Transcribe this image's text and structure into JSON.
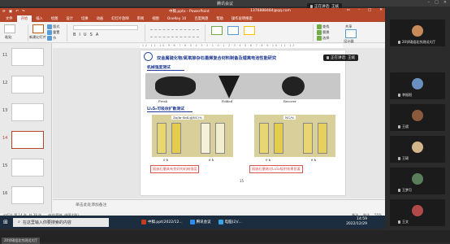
{
  "meeting": {
    "title": "腾讯会议",
    "speaker_label": "正在讲话: 王斌"
  },
  "ppt": {
    "doc_title": "中稿.pptx - PowerPoint",
    "account": "1376888484@qq.com",
    "tabs": [
      "文件",
      "开始",
      "插入",
      "绘图",
      "设计",
      "切换",
      "动画",
      "幻灯片放映",
      "审阅",
      "视图",
      "OneKey 10",
      "百度网盘",
      "帮助",
      "操作说明搜索"
    ],
    "ribbon": {
      "paste": "粘贴",
      "new_slide": "新建幻灯片",
      "layout": "版式",
      "reset": "重置",
      "section": "节",
      "find": "查找",
      "replace": "替换",
      "select": "选择",
      "share": "共享",
      "designer": "设计器"
    },
    "thumb_numbers": [
      "11",
      "12",
      "13",
      "14",
      "15",
      "16"
    ],
    "ruler": "·12·11·10·9·8·7·6·5·4·3·2·1·0·1·2·3·4·5·6·7·8·9·10·11·12",
    "slide": {
      "title": "双金属硫化物/氮氧掺杂石墨烯复合材料制备及锂离电池性能研究",
      "sec1": "机械强度测试",
      "labels1": [
        "Fresh",
        "Folded",
        "Recover"
      ],
      "sec2": "Li₂S₆可吸收扩散测试",
      "img_titles": [
        "Zn/In-SnS₂@NC/%",
        "NC/%"
      ],
      "time_labels": [
        "0 h",
        "6 h",
        "0 h",
        "6 h"
      ],
      "cap1": "插嵌石墨具有良好的机械强度",
      "cap2": "插嵌石墨烯对Li₂S₆吸附效果显著",
      "page_no": "15"
    },
    "notes": "单击此处添加备注",
    "status_left": [
      "幻灯片 第 14 张, 共 38 张",
      "中文(简体, 中国大陆)"
    ],
    "status_right": [
      "备注",
      "批注",
      "55%"
    ]
  },
  "taskbar": {
    "search_placeholder": "在这里输入你要搜索的内容",
    "apps": [
      "中稿.ppt(2022/12...",
      "腾讯会议",
      "电脑(2)/..."
    ],
    "time": "14:59",
    "date": "2022/12/29"
  },
  "participants": [
    {
      "name": "20学硕组北京测试大厅",
      "color": "#c98a5a"
    },
    {
      "name": "李振阳",
      "color": "#6b8fbf"
    },
    {
      "name": "王斌",
      "color": "#8b5a3c"
    },
    {
      "name": "王硕",
      "color": "#d4b58a"
    },
    {
      "name": "王梦月",
      "color": "#5a7d5a"
    },
    {
      "name": "王文",
      "color": "#b04a4a"
    }
  ],
  "footer_chip": "20学硕组北京测试大厅"
}
